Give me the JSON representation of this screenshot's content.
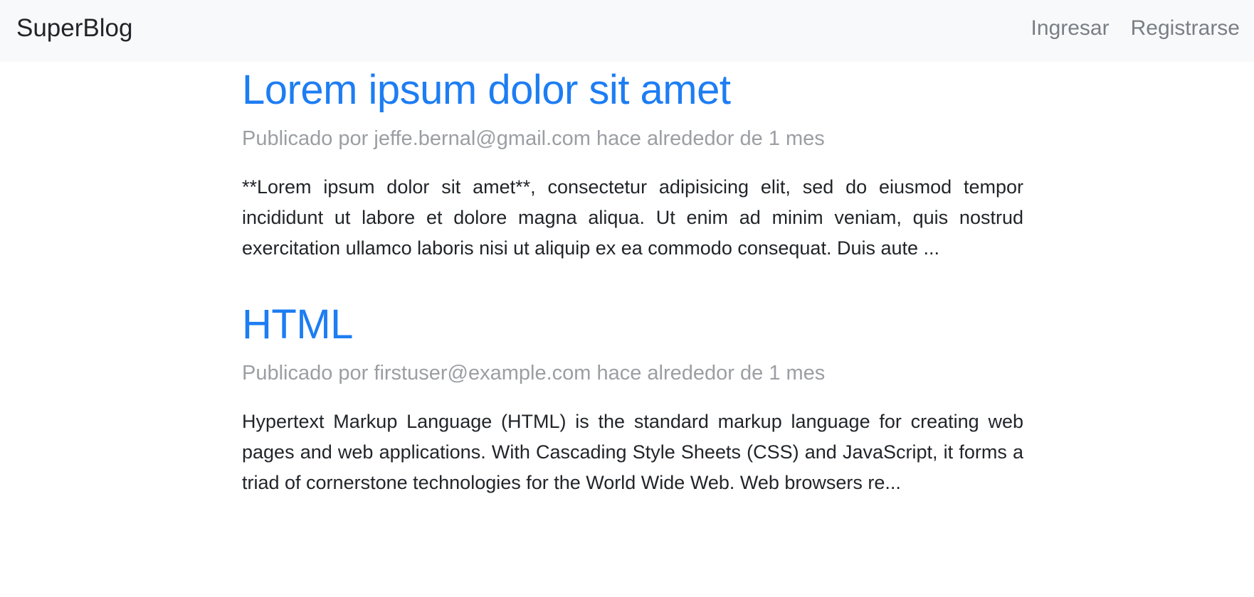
{
  "navbar": {
    "brand": "SuperBlog",
    "links": [
      {
        "label": "Ingresar"
      },
      {
        "label": "Registrarse"
      }
    ]
  },
  "posts": [
    {
      "title": "Lorem ipsum dolor sit amet",
      "meta": "Publicado por jeffe.bernal@gmail.com hace alrededor de 1 mes",
      "excerpt": "**Lorem ipsum dolor sit amet**, consectetur adipisicing elit, sed do eiusmod tempor incididunt ut labore et dolore magna aliqua. Ut enim ad minim veniam, quis nostrud exercitation ullamco laboris nisi ut aliquip ex ea commodo consequat. Duis aute ..."
    },
    {
      "title": "HTML",
      "meta": "Publicado por firstuser@example.com hace alrededor de 1 mes",
      "excerpt": "Hypertext Markup Language (HTML) is the standard markup language for creating web pages and web applications. With Cascading Style Sheets (CSS) and JavaScript, it forms a triad of cornerstone technologies for the World Wide Web. Web browsers re..."
    }
  ],
  "colors": {
    "navbar_bg": "#f8f9fa",
    "link_primary": "#1d7df3",
    "muted_text": "#9b9ea3",
    "nav_link": "#7a7f85",
    "body_text": "#212529"
  }
}
